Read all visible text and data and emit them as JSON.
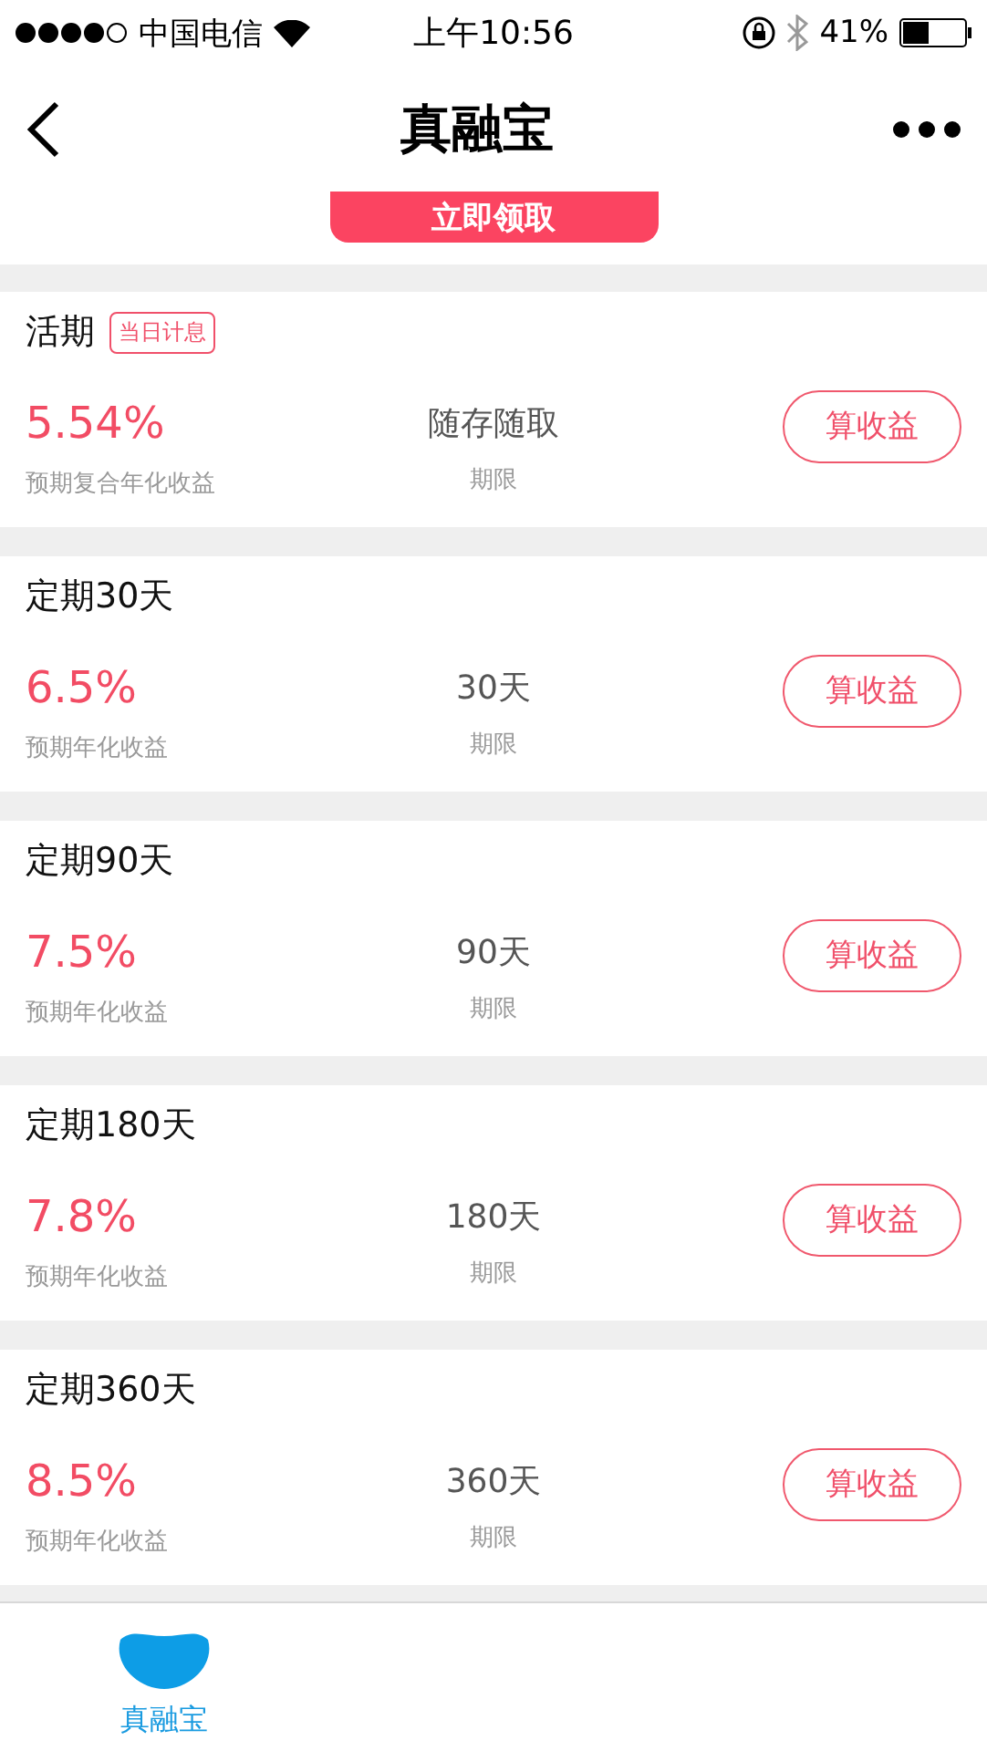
{
  "status_bar": {
    "carrier": "中国电信",
    "time": "上午10:56",
    "battery": "41%"
  },
  "nav": {
    "title": "真融宝"
  },
  "promo": {
    "button": "立即领取"
  },
  "products": [
    {
      "title": "活期",
      "tag": "当日计息",
      "rate": "5.54%",
      "rate_label": "预期复合年化收益",
      "term": "随存随取",
      "term_label": "期限",
      "button": "算收益"
    },
    {
      "title": "定期30天",
      "rate": "6.5%",
      "rate_label": "预期年化收益",
      "term": "30天",
      "term_label": "期限",
      "button": "算收益"
    },
    {
      "title": "定期90天",
      "rate": "7.5%",
      "rate_label": "预期年化收益",
      "term": "90天",
      "term_label": "期限",
      "button": "算收益"
    },
    {
      "title": "定期180天",
      "rate": "7.8%",
      "rate_label": "预期年化收益",
      "term": "180天",
      "term_label": "期限",
      "button": "算收益"
    },
    {
      "title": "定期360天",
      "rate": "8.5%",
      "rate_label": "预期年化收益",
      "term": "360天",
      "term_label": "期限",
      "button": "算收益"
    }
  ],
  "tabs": [
    {
      "label": "真融宝",
      "selected": true
    }
  ]
}
